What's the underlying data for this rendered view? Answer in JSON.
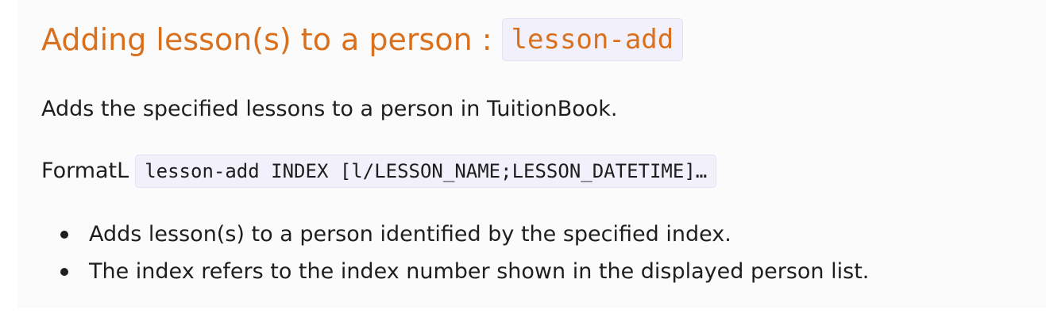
{
  "heading": {
    "text": "Adding lesson(s) to a person :",
    "code": "lesson-add"
  },
  "description": "Adds the specified lessons to a person in TuitionBook.",
  "format": {
    "label": "FormatL",
    "code": "lesson-add INDEX [l/LESSON_NAME;LESSON_DATETIME]…"
  },
  "bullets": [
    "Adds lesson(s) to a person identified by the specified index.",
    "The index refers to the index number shown in the displayed person list."
  ],
  "colors": {
    "heading": "#d9701e",
    "code_background": "#f1f0fb",
    "body_text": "#1e1e1e",
    "page_background": "#fbfbfb"
  }
}
